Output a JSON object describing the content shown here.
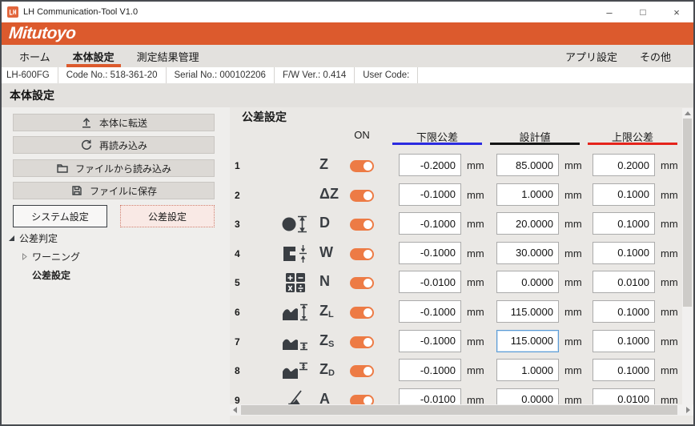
{
  "theme": {
    "accent": "#dc5a2d",
    "toggle_on": "#ed7b45",
    "focus_border": "#5b9bd5",
    "lower_underline": "#2b2be0",
    "design_underline": "#141414",
    "upper_underline": "#e5231b"
  },
  "window": {
    "title": "LH Communication-Tool V1.0",
    "controls": {
      "minimize": "–",
      "maximize": "□",
      "close": "×"
    }
  },
  "brand": {
    "logo_text": "Mitutoyo"
  },
  "nav": {
    "tabs": [
      {
        "label": "ホーム",
        "active": false
      },
      {
        "label": "本体設定",
        "active": true
      },
      {
        "label": "測定結果管理",
        "active": false
      }
    ],
    "right_tabs": [
      {
        "label": "アプリ設定"
      },
      {
        "label": "その他"
      }
    ]
  },
  "device_info": {
    "model": "LH-600FG",
    "code_no": "Code No.: 518-361-20",
    "serial_no": "Serial No.: 000102206",
    "fw_ver": "F/W Ver.: 0.414",
    "user_code": "User Code:"
  },
  "page": {
    "title": "本体設定"
  },
  "sidebar": {
    "action_buttons": [
      {
        "label": "本体に転送",
        "icon": "upload-icon"
      },
      {
        "label": "再読み込み",
        "icon": "refresh-icon"
      },
      {
        "label": "ファイルから読み込み",
        "icon": "folder-icon"
      },
      {
        "label": "ファイルに保存",
        "icon": "save-icon"
      }
    ],
    "mode_buttons": [
      {
        "label": "システム設定",
        "selected": false
      },
      {
        "label": "公差設定",
        "selected": true
      }
    ],
    "tree": {
      "root": "公差判定",
      "children": [
        {
          "label": "ワーニング",
          "selected": false
        },
        {
          "label": "公差設定",
          "selected": true
        }
      ]
    }
  },
  "tolerance_panel": {
    "title": "公差設定",
    "columns": {
      "on": "ON",
      "lower": "下限公差",
      "design": "設計値",
      "upper": "上限公差"
    },
    "unit": "mm",
    "rows": [
      {
        "no": "1",
        "label": "Z",
        "sub": "",
        "icon": "",
        "on": true,
        "lower": "-0.2000",
        "design": "85.0000",
        "upper": "0.2000",
        "design_focused": false
      },
      {
        "no": "2",
        "label": "ΔZ",
        "sub": "",
        "icon": "",
        "on": true,
        "lower": "-0.1000",
        "design": "1.0000",
        "upper": "0.1000",
        "design_focused": false
      },
      {
        "no": "3",
        "label": "D",
        "sub": "",
        "icon": "circle-diameter-icon",
        "on": true,
        "lower": "-0.1000",
        "design": "20.0000",
        "upper": "0.1000",
        "design_focused": false
      },
      {
        "no": "4",
        "label": "W",
        "sub": "",
        "icon": "width-step-icon",
        "on": true,
        "lower": "-0.1000",
        "design": "30.0000",
        "upper": "0.1000",
        "design_focused": false
      },
      {
        "no": "5",
        "label": "N",
        "sub": "",
        "icon": "calculator-icon",
        "on": true,
        "lower": "-0.0100",
        "design": "0.0000",
        "upper": "0.0100",
        "design_focused": false
      },
      {
        "no": "6",
        "label": "Z",
        "sub": "L",
        "icon": "peak-height-icon",
        "on": true,
        "lower": "-0.1000",
        "design": "115.0000",
        "upper": "0.1000",
        "design_focused": false
      },
      {
        "no": "7",
        "label": "Z",
        "sub": "S",
        "icon": "valley-height-icon",
        "on": true,
        "lower": "-0.1000",
        "design": "115.0000",
        "upper": "0.1000",
        "design_focused": true
      },
      {
        "no": "8",
        "label": "Z",
        "sub": "D",
        "icon": "peak-diff-icon",
        "on": true,
        "lower": "-0.1000",
        "design": "1.0000",
        "upper": "0.1000",
        "design_focused": false
      },
      {
        "no": "9",
        "label": "A",
        "sub": "",
        "icon": "angle-icon",
        "on": true,
        "lower": "-0.0100",
        "design": "0.0000",
        "upper": "0.0100",
        "design_focused": false
      }
    ]
  }
}
